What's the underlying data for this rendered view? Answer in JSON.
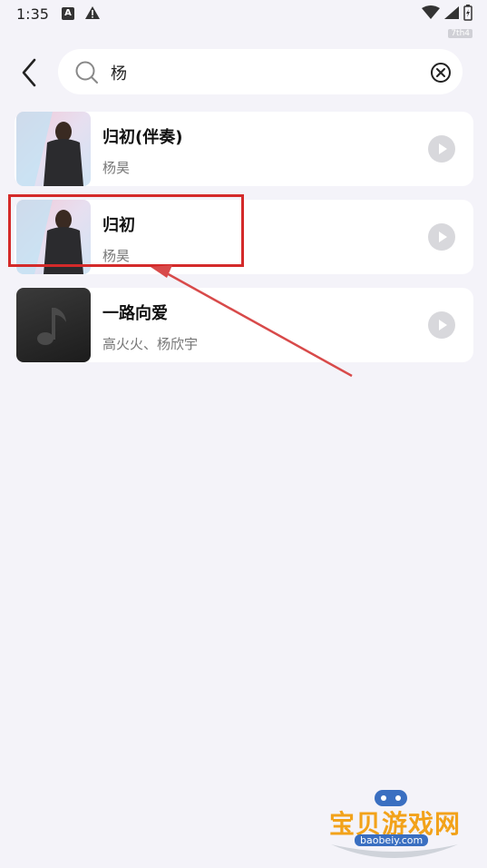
{
  "status": {
    "time": "1:35",
    "badge": "7th4"
  },
  "search": {
    "value": "杨",
    "placeholder": ""
  },
  "results": [
    {
      "title": "归初(伴奏)",
      "artist": "杨昊",
      "cover": "photo"
    },
    {
      "title": "归初",
      "artist": "杨昊",
      "cover": "photo"
    },
    {
      "title": "一路向爱",
      "artist": "高火火、杨欣宇",
      "cover": "dark"
    }
  ],
  "watermark": {
    "text": "宝贝游戏网",
    "url": "baobeiy.com"
  },
  "colors": {
    "highlight": "#d42a2a",
    "accent_watermark": "#f2a21a"
  }
}
